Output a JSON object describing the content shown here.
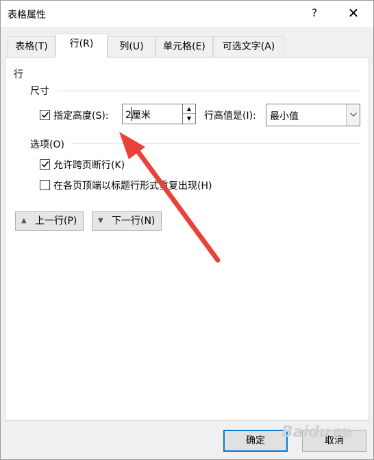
{
  "window": {
    "title": "表格属性",
    "help_label": "?",
    "close_label": "✕"
  },
  "tabs": [
    {
      "label": "表格(T)",
      "active": false
    },
    {
      "label": "行(R)",
      "active": true
    },
    {
      "label": "列(U)",
      "active": false
    },
    {
      "label": "单元格(E)",
      "active": false
    },
    {
      "label": "可选文字(A)",
      "active": false
    }
  ],
  "row_panel": {
    "heading": "行",
    "size_group": "尺寸",
    "specify_height": {
      "label": "指定高度(S):",
      "checked": true
    },
    "height_value": "2厘米",
    "row_height_is_label": "行高值是(I):",
    "row_height_is_value": "最小值",
    "options_group": "选项(O)",
    "allow_break": {
      "label": "允许跨页断行(K)",
      "checked": true
    },
    "repeat_header": {
      "label": "在各页顶端以标题行形式重复出现(H)",
      "checked": false
    },
    "prev_row_label": "上一行(P)",
    "next_row_label": "下一行(N)"
  },
  "footer": {
    "ok_label": "确定",
    "cancel_label": "取消"
  },
  "watermark": {
    "brand": "Baidu",
    "sub": "经验"
  },
  "colors": {
    "annotation_arrow": "#e8423a",
    "focus_border": "#0078d7"
  },
  "icons": {
    "checkmark": "check-icon",
    "spin_up": "spin-up-icon",
    "spin_down": "spin-down-icon",
    "dropdown": "chevron-down-icon",
    "prev": "triangle-up-icon",
    "next": "triangle-down-icon"
  }
}
